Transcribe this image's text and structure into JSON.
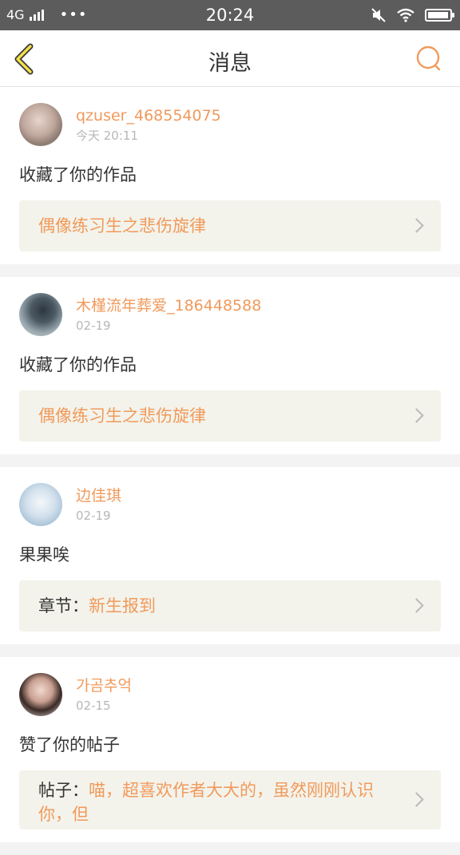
{
  "status_bar": {
    "network": "4G",
    "dots": "•••",
    "time": "20:24",
    "battery_level": 0.95
  },
  "header": {
    "title": "消息",
    "accent_color": "#f19a5b"
  },
  "messages": [
    {
      "username": "qzuser_468554075",
      "time": "今天 20:11",
      "action": "收藏了你的作品",
      "ref_prefix": "",
      "ref_text": "偶像练习生之悲伤旋律"
    },
    {
      "username": "木槿流年葬爱_186448588",
      "time": "02-19",
      "action": "收藏了你的作品",
      "ref_prefix": "",
      "ref_text": "偶像练习生之悲伤旋律"
    },
    {
      "username": "边佳琪",
      "time": "02-19",
      "action": "果果唉",
      "ref_prefix": "章节：",
      "ref_text": "新生报到"
    },
    {
      "username": "가곰추억",
      "time": "02-15",
      "action": "赞了你的帖子",
      "ref_prefix": "帖子：",
      "ref_text": "喵，超喜欢作者大大的，虽然刚刚认识你，但"
    }
  ]
}
